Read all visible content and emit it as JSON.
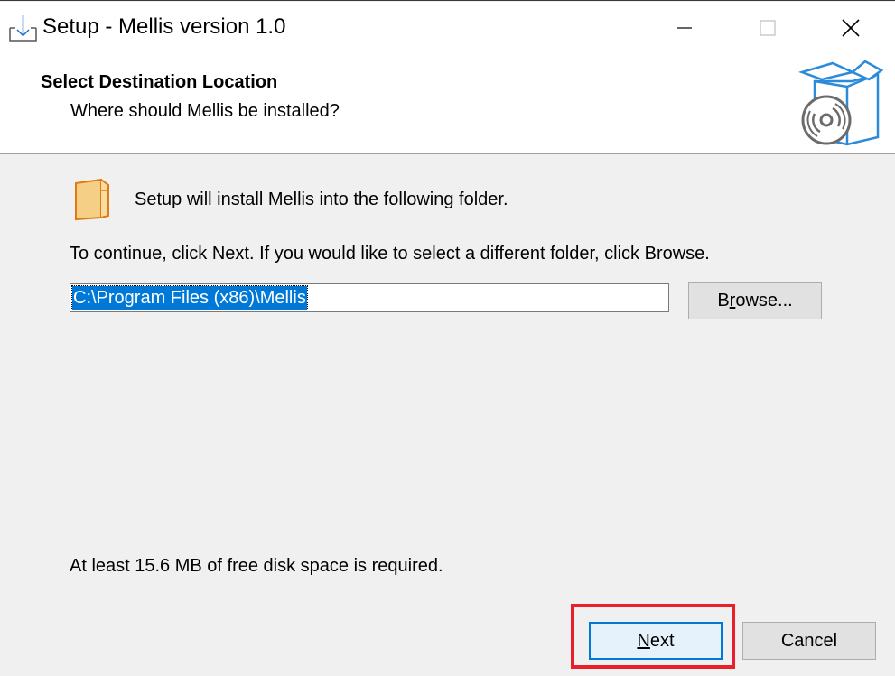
{
  "window": {
    "title": "Setup - Mellis version 1.0"
  },
  "header": {
    "title": "Select Destination Location",
    "subtitle": "Where should Mellis be installed?",
    "art_icon": "software-box-cd-icon"
  },
  "body": {
    "intro": "Setup will install Mellis into the following folder.",
    "continue_hint": "To continue, click Next. If you would like to select a different folder, click Browse.",
    "path_value": "C:\\Program Files (x86)\\Mellis",
    "browse_label_pre": "B",
    "browse_label_accel": "r",
    "browse_label_post": "owse...",
    "disk_space": "At least 15.6 MB of free disk space is required."
  },
  "footer": {
    "next_accel": "N",
    "next_rest": "ext",
    "cancel_label": "Cancel"
  },
  "colors": {
    "selection": "#0078d7",
    "highlight": "#e8202a",
    "folder": "#f6cf86"
  }
}
